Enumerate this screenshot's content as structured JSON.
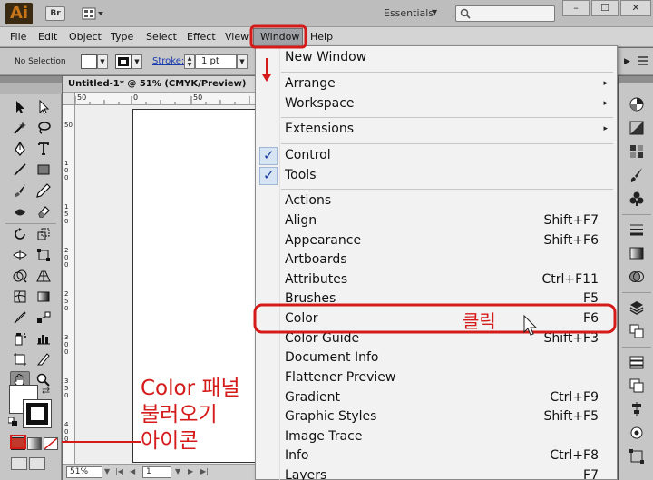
{
  "app": {
    "logo_text": "Ai",
    "bridge_button": "Br",
    "workspace_switcher": "Essentials",
    "window_controls": [
      "–",
      "☐",
      "✕"
    ]
  },
  "menubar": {
    "items": [
      "File",
      "Edit",
      "Object",
      "Type",
      "Select",
      "Effect",
      "View",
      "Window",
      "Help"
    ],
    "active": "Window"
  },
  "controlbar": {
    "selection_status": "No Selection",
    "stroke_label": "Stroke:",
    "stroke_weight": "1 pt"
  },
  "document": {
    "tab_title": "Untitled-1* @ 51% (CMYK/Preview)",
    "zoom": "51%",
    "artboard_number": "1",
    "ruler_top_labels": [
      "50",
      "0",
      "50"
    ],
    "ruler_left_labels": [
      "50",
      "100",
      "150",
      "200",
      "250",
      "300",
      "350",
      "400"
    ]
  },
  "window_menu": {
    "items": [
      {
        "label": "New Window",
        "shortcut": ""
      },
      {
        "label": "Arrange",
        "shortcut": "",
        "submenu": true
      },
      {
        "label": "Workspace",
        "shortcut": "",
        "submenu": true
      },
      {
        "label": "Extensions",
        "shortcut": "",
        "submenu": true
      },
      {
        "label": "Control",
        "shortcut": "",
        "checked": true
      },
      {
        "label": "Tools",
        "shortcut": "",
        "checked": true
      },
      {
        "label": "Actions",
        "shortcut": ""
      },
      {
        "label": "Align",
        "shortcut": "Shift+F7"
      },
      {
        "label": "Appearance",
        "shortcut": "Shift+F6"
      },
      {
        "label": "Artboards",
        "shortcut": ""
      },
      {
        "label": "Attributes",
        "shortcut": "Ctrl+F11"
      },
      {
        "label": "Brushes",
        "shortcut": "F5"
      },
      {
        "label": "Color",
        "shortcut": "F6"
      },
      {
        "label": "Color Guide",
        "shortcut": "Shift+F3"
      },
      {
        "label": "Document Info",
        "shortcut": ""
      },
      {
        "label": "Flattener Preview",
        "shortcut": ""
      },
      {
        "label": "Gradient",
        "shortcut": "Ctrl+F9"
      },
      {
        "label": "Graphic Styles",
        "shortcut": "Shift+F5"
      },
      {
        "label": "Image Trace",
        "shortcut": ""
      },
      {
        "label": "Info",
        "shortcut": "Ctrl+F8"
      },
      {
        "label": "Layers",
        "shortcut": "F7"
      }
    ],
    "check_mark": "✓",
    "submenu_arrow": "▸"
  },
  "annotations": {
    "click_label": "클릭",
    "side_note_lines": [
      "Color 패널",
      "불러오기",
      "아이콘"
    ],
    "color": "#d51a1a"
  },
  "colors": {
    "annotation_red": "#d51a1a",
    "menu_bg": "#f2f2f2",
    "check_blue": "#1c3fa0"
  }
}
